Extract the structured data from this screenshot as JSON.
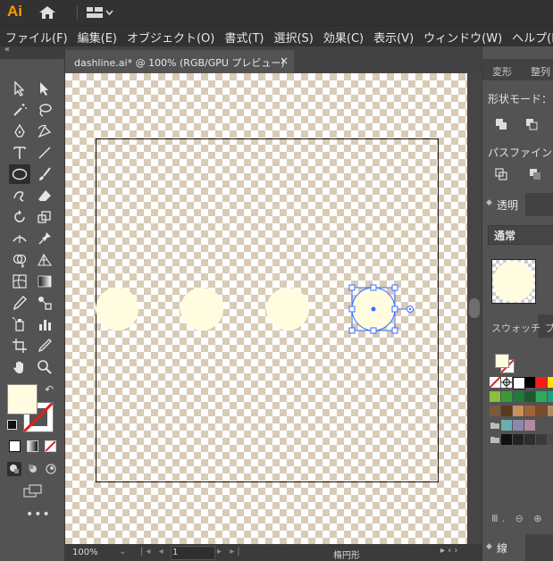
{
  "app": {
    "logo_text": "Ai",
    "menu": [
      "ファイル(F)",
      "編集(E)",
      "オブジェクト(O)",
      "書式(T)",
      "選択(S)",
      "効果(C)",
      "表示(V)",
      "ウィンドウ(W)",
      "ヘルプ(H)"
    ]
  },
  "document": {
    "tab_title": "dashline.ai* @ 100% (RGB/GPU プレビュー)",
    "close_glyph": "×"
  },
  "status": {
    "zoom": "100%",
    "artboard_number": "1",
    "tool_name": "楕円形"
  },
  "panels": {
    "top_tabs": [
      "変形",
      "整列"
    ],
    "pathfinder": {
      "shape_mode_label": "形状モード：",
      "pathfinder_label": "パスファインダ"
    },
    "transparency": {
      "tab": "透明",
      "blend_mode": "通常"
    },
    "swatches": {
      "tab": "スウォッチ",
      "tab2_partial": "ブ"
    },
    "stroke": {
      "tab": "線"
    }
  },
  "colors": {
    "fill": "#fffce0",
    "selection": "#3b6eff",
    "accent_logo": "#ff9a00"
  },
  "swatch_rows": [
    [
      "none",
      "registration",
      "#ffffff",
      "#000000",
      "#ff1a1a",
      "#ffe600"
    ],
    [
      "#8cbf3f",
      "#3a9a3a",
      "#1d7a3a",
      "#1e5a2e",
      "#2eaa5a",
      "#1fa078"
    ],
    [
      "#7a5a3a",
      "#5a3a1f",
      "#c8905a",
      "#a0643a",
      "#7a4a2a",
      "#b08a5a"
    ],
    [
      "folder",
      "#6ab0b0",
      "#8a8ab0",
      "#b08aa0",
      "",
      ""
    ],
    [
      "folder",
      "#111111",
      "#222222",
      "#2e2e2e",
      "#3a3a3a",
      "#4a4a4a"
    ]
  ]
}
